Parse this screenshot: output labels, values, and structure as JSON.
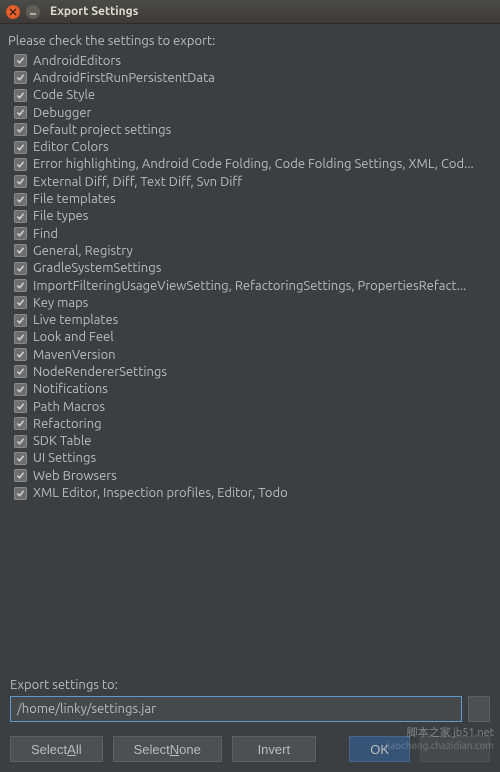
{
  "window": {
    "title": "Export Settings"
  },
  "instruction": "Please check the settings to export:",
  "items": [
    "AndroidEditors",
    "AndroidFirstRunPersistentData",
    "Code Style",
    "Debugger",
    "Default project settings",
    "Editor Colors",
    "Error highlighting, Android Code Folding, Code Folding Settings, XML, Cod...",
    "External Diff, Diff, Text Diff, Svn Diff",
    "File templates",
    "File types",
    "Find",
    "General, Registry",
    "GradleSystemSettings",
    "ImportFilteringUsageViewSetting, RefactoringSettings, PropertiesRefact...",
    "Key maps",
    "Live templates",
    "Look and Feel",
    "MavenVersion",
    "NodeRendererSettings",
    "Notifications",
    "Path Macros",
    "Refactoring",
    "SDK Table",
    "UI Settings",
    "Web Browsers",
    "XML Editor, Inspection profiles, Editor, Todo"
  ],
  "export": {
    "label": "Export settings to:",
    "path": "/home/linky/settings.jar"
  },
  "buttons": {
    "select_all_pre": "Select ",
    "select_all_ul": "A",
    "select_all_post": "ll",
    "select_none_pre": "Select ",
    "select_none_ul": "N",
    "select_none_post": "one",
    "invert": "Invert",
    "ok": "OK"
  },
  "watermark": {
    "line1": "脚本之家 jb51.net",
    "line2": "jiaocheng.chazidian.com"
  },
  "colors": {
    "accent": "#5f9bca",
    "bg": "#3c3f41",
    "text": "#bbbbbb"
  }
}
